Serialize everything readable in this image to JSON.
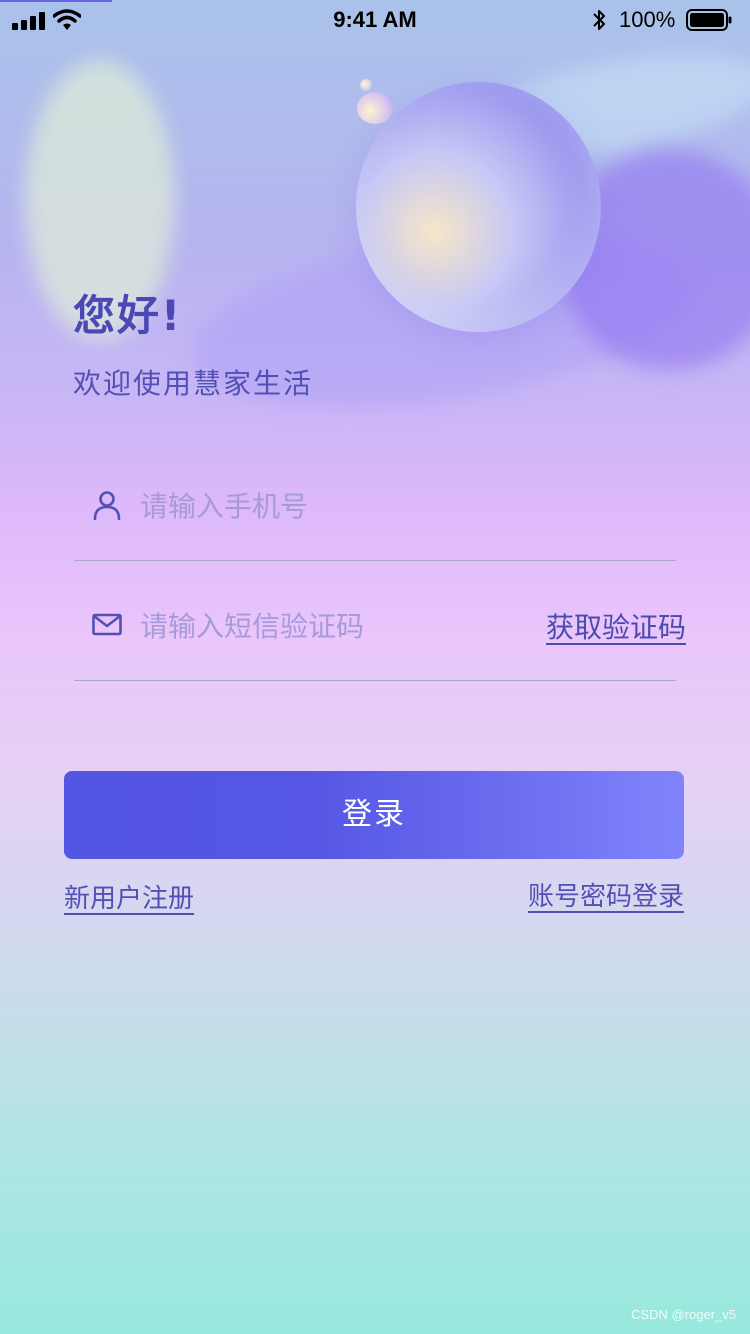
{
  "status_bar": {
    "time": "9:41 AM",
    "battery_percent": "100%",
    "icons": [
      "cellular-signal-icon",
      "wifi-icon",
      "bluetooth-icon",
      "battery-icon"
    ]
  },
  "greeting": {
    "title": "您好!",
    "subtitle": "欢迎使用慧家生活"
  },
  "form": {
    "phone": {
      "icon": "user-icon",
      "placeholder": "请输入手机号",
      "value": ""
    },
    "code": {
      "icon": "mail-icon",
      "placeholder": "请输入短信验证码",
      "value": "",
      "get_code_label": "获取验证码"
    },
    "login_label": "登录"
  },
  "links": {
    "register": "新用户注册",
    "password_login": "账号密码登录"
  },
  "watermark": "CSDN @roger_v5",
  "colors": {
    "accent": "#5356e2",
    "text_primary": "#4b48b6",
    "placeholder": "#a69ad8"
  }
}
